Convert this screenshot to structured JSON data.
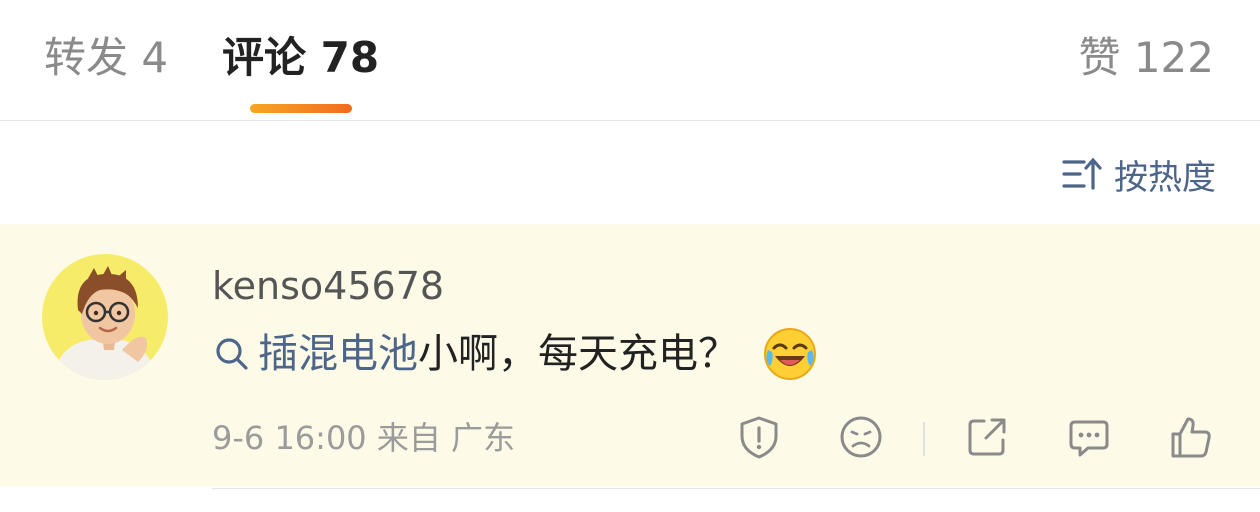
{
  "tabs": {
    "repost": "转发 4",
    "comments": "评论 78",
    "likes": "赞 122"
  },
  "sort": {
    "label": "按热度"
  },
  "comment": {
    "username": "kenso45678",
    "topic": "插混电池",
    "text": "小啊，每天充电？",
    "meta": "9-6 16:00 来自 广东"
  },
  "colors": {
    "accent": "#f26b1d",
    "link": "#4d6589",
    "highlight_bg": "#fdfbe8"
  }
}
